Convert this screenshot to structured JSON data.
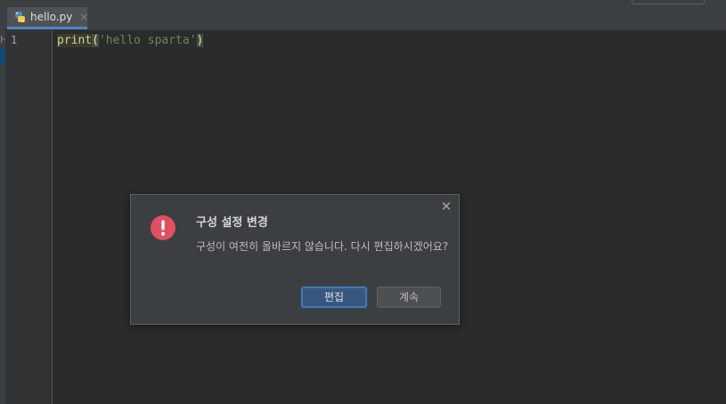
{
  "editor": {
    "tab": {
      "filename": "hello.py",
      "close_glyph": "×"
    },
    "left_glyph": "H",
    "line_number": "1",
    "code": {
      "fn": "print",
      "open": "(",
      "string": "'hello sparta'",
      "close": ")"
    }
  },
  "dialog": {
    "title": "구성 설정 변경",
    "message": "구성이 여전히 올바르지 않습니다. 다시 편집하시겠어요?",
    "close_glyph": "✕",
    "primary_button": "편집",
    "secondary_button": "계속",
    "icon": "error-icon"
  },
  "colors": {
    "background": "#2b2b2b",
    "accent": "#365880",
    "error": "#e0505e",
    "string": "#6a8759"
  }
}
